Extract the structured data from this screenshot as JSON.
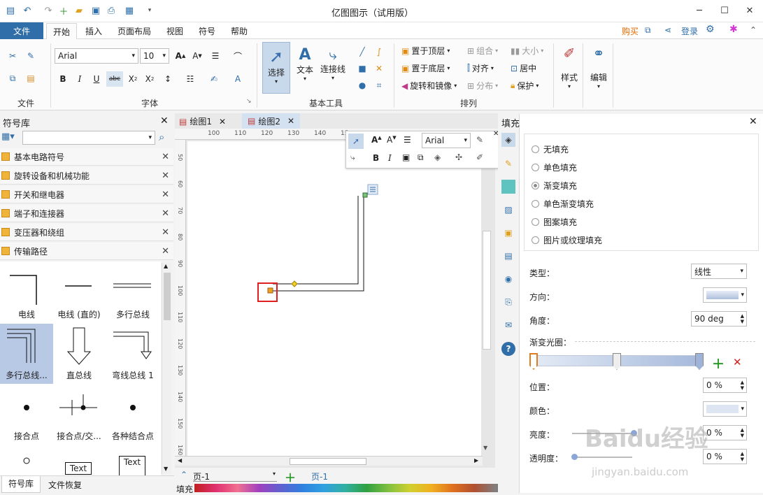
{
  "app": {
    "title": "亿图图示（试用版）"
  },
  "menu": {
    "file": "文件",
    "tabs": [
      "开始",
      "插入",
      "页面布局",
      "视图",
      "符号",
      "帮助"
    ],
    "buy": "购买",
    "login": "登录"
  },
  "ribbon": {
    "groups": {
      "file": "文件",
      "font": "字体",
      "basic_tools": "基本工具",
      "arrange": "排列"
    },
    "font_name": "Arial",
    "font_size": "10",
    "tools": {
      "select": "选择",
      "text": "文本",
      "connector": "连接线"
    },
    "arrange": {
      "bring_top": "置于顶层",
      "send_bottom": "置于底层",
      "rotate": "旋转和镜像",
      "group": "组合",
      "align": "对齐",
      "distribute": "分布",
      "size": "大小",
      "center": "居中",
      "protect": "保护"
    },
    "style": "样式",
    "edit": "编辑"
  },
  "symbol_lib": {
    "title": "符号库",
    "categories": [
      "基本电路符号",
      "旋转设备和机械功能",
      "开关和继电器",
      "端子和连接器",
      "变压器和绕组",
      "传输路径"
    ],
    "shapes": [
      "电线",
      "电线 (直的)",
      "多行总线",
      "多行总线...",
      "直总线",
      "弯线总线 1",
      "接合点",
      "接合点/交...",
      "各种结合点",
      "",
      "Text",
      "Text"
    ],
    "bottom_tabs": [
      "符号库",
      "文件恢复"
    ]
  },
  "doc_tabs": [
    "绘图1",
    "绘图2"
  ],
  "ruler": {
    "h": [
      "100",
      "110",
      "120",
      "130",
      "140",
      "15"
    ],
    "v": [
      "50",
      "60",
      "70",
      "80",
      "90",
      "100",
      "110",
      "120",
      "130",
      "140",
      "150",
      "160"
    ]
  },
  "float_toolbar": {
    "font": "Arial"
  },
  "page_bar": {
    "page": "页-1",
    "active_page": "页-1"
  },
  "fill_panel": {
    "title": "填充",
    "options": [
      "无填充",
      "单色填充",
      "渐变填充",
      "单色渐变填充",
      "图案填充",
      "图片或纹理填充"
    ],
    "selected": "渐变填充",
    "type_label": "类型：",
    "type_value": "线性",
    "direction_label": "方向：",
    "angle_label": "角度：",
    "angle_value": "90 deg",
    "gradient_label": "渐变光圈：",
    "position_label": "位置：",
    "position_value": "0 %",
    "color_label": "颜色：",
    "brightness_label": "亮度：",
    "brightness_value": "0 %",
    "transparency_label": "透明度：",
    "transparency_value": "0 %"
  },
  "status": {
    "fill": "填充"
  },
  "watermark": {
    "text": "Baidu经验",
    "url": "jingyan.baidu.com"
  }
}
